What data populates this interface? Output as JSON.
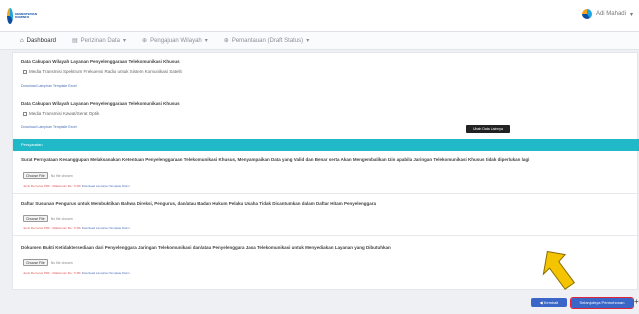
{
  "header": {
    "logo_text": "KEMENTERIAN KOMINFO",
    "user_name": "Adi Mahadi"
  },
  "tabs": [
    {
      "label": "Dashboard",
      "icon": "home-icon"
    },
    {
      "label": "Perizinan Data",
      "icon": "file-icon"
    },
    {
      "label": "Pengajuan Wilayah",
      "icon": "plus-icon"
    },
    {
      "label": "Pemantauan (Draft Status)",
      "icon": "plus-icon"
    }
  ],
  "coverage": [
    {
      "title": "Data Cakupan Wilayah Layanan Penyelenggaraan Telekomunikasi Khusus",
      "option": "Media Transmisi Spektrum Frekuensi Radio untuk Sistem Komunikasi Satelit",
      "link": "Download Lampiran Template Excel"
    },
    {
      "title": "Data Cakupan Wilayah Layanan Penyelenggaraan Telekomunikasi Khusus",
      "option": "Media Transmisi Kawat/Serat Optik",
      "link": "Download Lampiran Template Excel"
    }
  ],
  "section": {
    "title": "Persyaratan"
  },
  "requirements": [
    {
      "title": "Surat Pernyataan Kesanggupan Melaksanakan Ketentuan Penyelenggaraan Telekomunikasi Khusus, Menyampaikan Data yang Valid dan Benar serta Akan Mengembalikan Izin apabila Jaringan Telekomunikasi Khusus tidak diperlukan lagi",
      "choose": "Choose File",
      "nofile": "No file chosen",
      "hint": "Jenis file harus PDF · Maksimum file : 5 Mb",
      "hint_link": "Download Lampiran Template Disini"
    },
    {
      "title": "Daftar Susunan Pengurus untuk Membuktikan Bahwa Direksi, Pengurus, dan/atau Badan Hukum Pelaku Usaha Tidak Dicantumkan dalam Daftar Hitam Penyelenggara",
      "choose": "Choose File",
      "nofile": "No file chosen",
      "hint": "Jenis file harus PDF · Maksimum file : 5 Mb",
      "hint_link": "Download Lampiran Template Disini"
    },
    {
      "title": "Dokumen Bukti Ketidaktersediaan dari Penyelenggara Jaringan Telekomunikasi dan/atau Penyelenggara Jasa Telekomunikasi untuk Menyediakan Layanan yang Dibutuhkan",
      "choose": "Choose File",
      "nofile": "No file chosen",
      "hint": "Jenis file harus PDF · Maksimum file : 5 Mb",
      "hint_link": "Download Lampiran Template Disini"
    }
  ],
  "tooltip": "Ubah Data Lainnya",
  "actions": {
    "back": "◀ Kembali",
    "save": "Selanjutnya Permohonan",
    "plus": "+"
  },
  "colors": {
    "section_bar": "#21b8c8",
    "primary": "#3a66c8",
    "highlight": "#e0243a",
    "arrow": "#f5c400"
  }
}
